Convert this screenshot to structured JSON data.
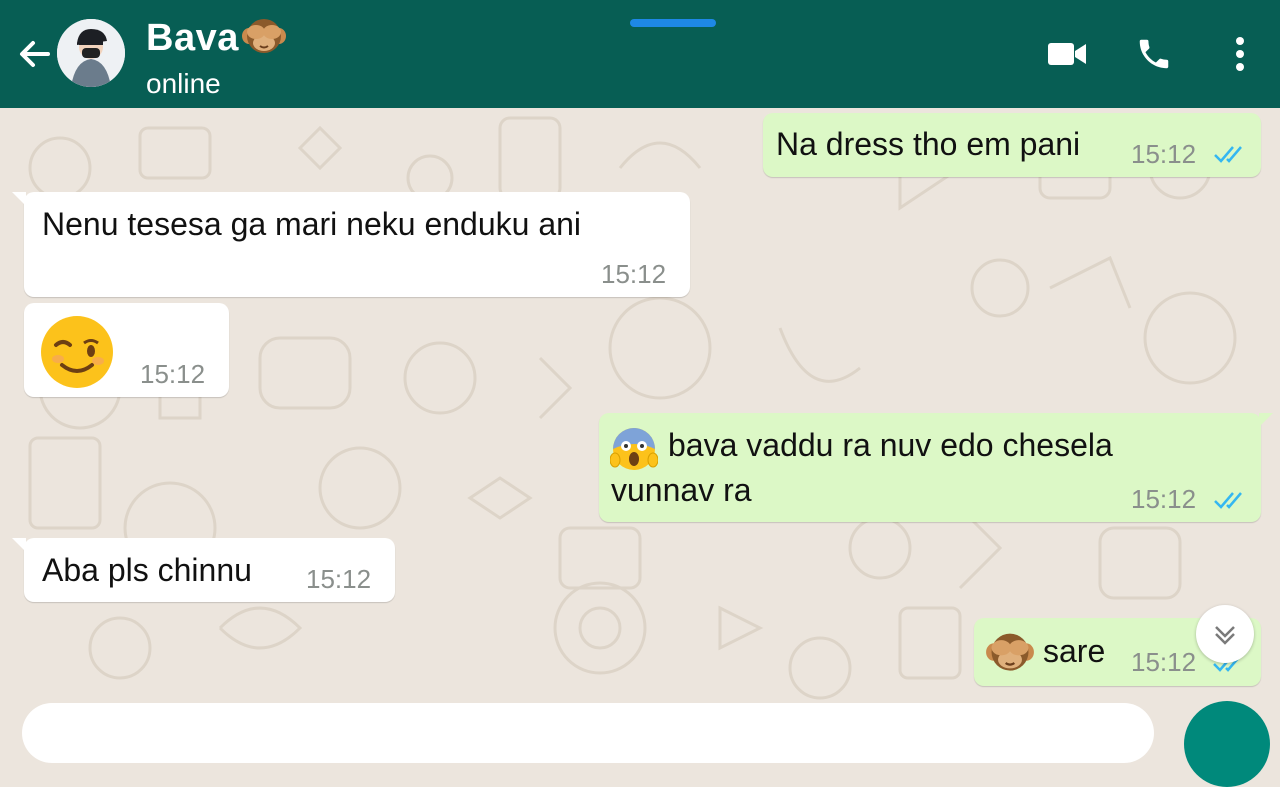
{
  "header": {
    "contact_name": "Bava",
    "status": "online",
    "icons": {
      "back": "arrow-left-icon",
      "video": "video-call-icon",
      "voice": "phone-icon",
      "menu": "more-vertical-icon"
    },
    "background_color": "#075e54"
  },
  "messages": [
    {
      "direction": "out",
      "text": "Na dress tho em pani",
      "time": "15:12",
      "status": "read"
    },
    {
      "direction": "in",
      "text": "Nenu tesesa ga mari neku enduku ani",
      "time": "15:12"
    },
    {
      "direction": "in",
      "emoji": "winking-face",
      "time": "15:12"
    },
    {
      "direction": "out",
      "emoji": "face-screaming-in-fear",
      "line1": "bava vaddu ra nuv edo chesela",
      "line2": "vunnav ra",
      "time": "15:12",
      "status": "read"
    },
    {
      "direction": "in",
      "text": "Aba pls chinnu",
      "time": "15:12"
    },
    {
      "direction": "out",
      "emoji": "see-no-evil-monkey",
      "text": "sare",
      "time": "15:12",
      "status": "read"
    }
  ],
  "colors": {
    "incoming": "#ffffff",
    "outgoing": "#dcf8c6",
    "read_ticks": "#34b7f1",
    "wallpaper": "#ece5dd"
  }
}
